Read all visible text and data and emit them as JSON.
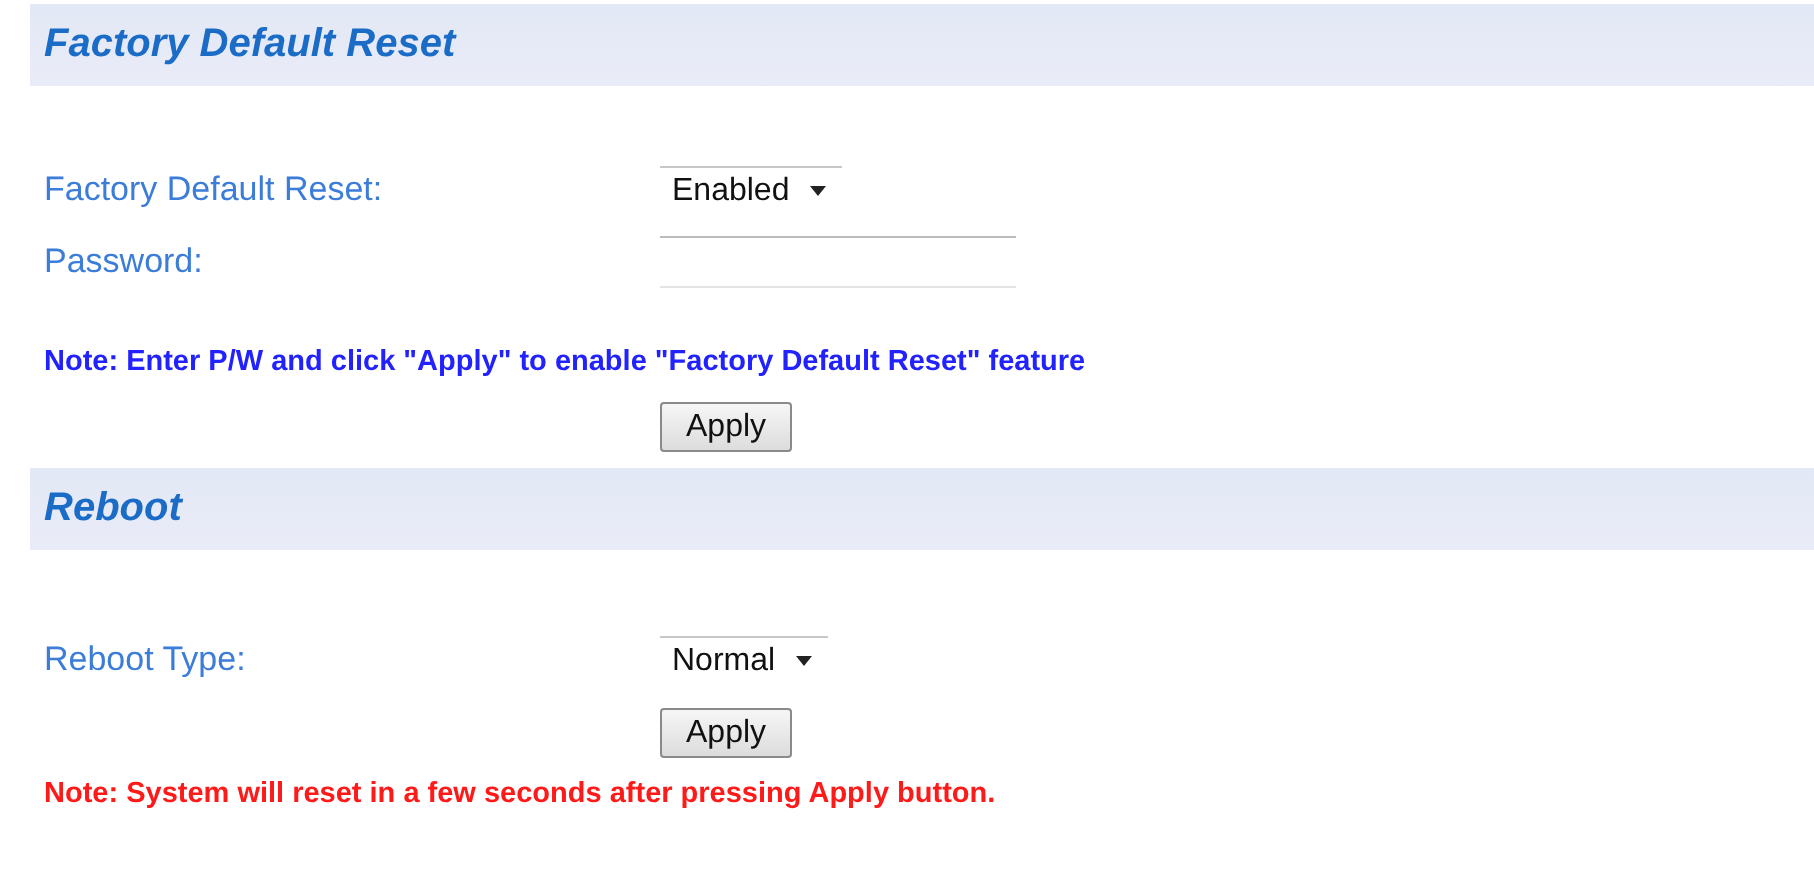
{
  "sections": [
    {
      "title": "Factory Default Reset",
      "items": [
        {
          "kind": "select",
          "label": "Factory Default Reset:",
          "value": "Enabled"
        },
        {
          "kind": "password",
          "label": "Password:"
        },
        {
          "kind": "note",
          "color": "#2222ff",
          "text": "Note: Enter P/W and click \"Apply\" to enable \"Factory Default Reset\" feature"
        },
        {
          "kind": "button",
          "label": "Apply"
        }
      ]
    },
    {
      "title": "Reboot",
      "items": [
        {
          "kind": "select",
          "label": "Reboot Type:",
          "value": "Normal"
        },
        {
          "kind": "button",
          "label": "Apply"
        },
        {
          "kind": "note",
          "color": "#ff1a1a",
          "text": "Note: System will reset in a few seconds after pressing Apply button."
        }
      ]
    }
  ]
}
